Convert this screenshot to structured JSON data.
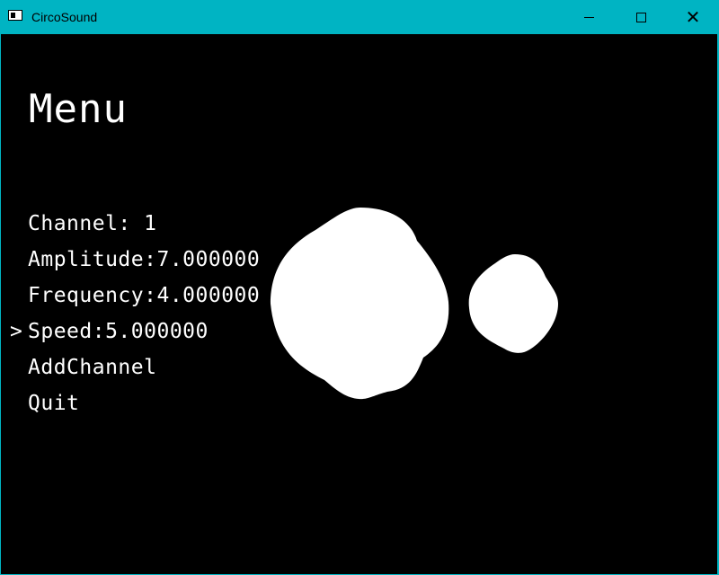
{
  "window": {
    "title": "CircoSound",
    "controls": {
      "minimize": "minimize",
      "maximize": "maximize",
      "close": "close"
    }
  },
  "menu": {
    "title": "Menu",
    "selected_indicator": ">",
    "selected_index": 3,
    "items": [
      {
        "label": "Channel: 1"
      },
      {
        "label": "Amplitude:7.000000"
      },
      {
        "label": "Frequency:4.000000"
      },
      {
        "label": "Speed:5.000000"
      },
      {
        "label": "AddChannel"
      },
      {
        "label": "Quit"
      }
    ]
  },
  "colors": {
    "titlebar": "#00b4c3",
    "background": "#000000",
    "foreground": "#ffffff"
  }
}
